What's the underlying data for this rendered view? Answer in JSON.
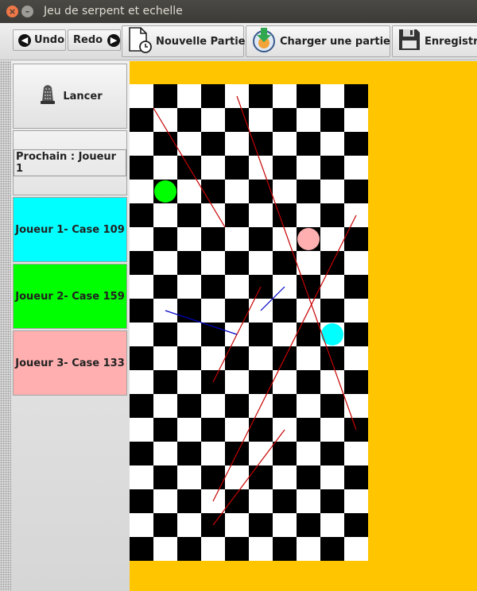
{
  "window": {
    "title": "Jeu de serpent et echelle",
    "close_glyph": "×",
    "minimize_glyph": "–"
  },
  "toolbar": {
    "undo_label": "Undo",
    "redo_label": "Redo",
    "new_game_label": "Nouvelle Partie",
    "load_game_label": "Charger une partie",
    "save_label": "Enregistr",
    "undo_glyph": "◀",
    "redo_glyph": "▶"
  },
  "side": {
    "roll_label": "Lancer",
    "next_label": "Prochain : Joueur 1",
    "players": [
      {
        "label": "Joueur 1- Case 109",
        "color": "#00ffff"
      },
      {
        "label": "Joueur 2- Case 159",
        "color": "#00ff00"
      },
      {
        "label": "Joueur 3- Case 133",
        "color": "#ffafaf"
      }
    ]
  },
  "board": {
    "columns": 10,
    "rows": 20,
    "dark_color": "#000000",
    "light_color": "#ffffff",
    "background_color": "#ffc600",
    "ladder_color": "#0000c8",
    "snake_color": "#c80000",
    "tokens": [
      {
        "player": "Joueur 1",
        "color": "#00ffff",
        "col": 8,
        "row": 10
      },
      {
        "player": "Joueur 2",
        "color": "#00ff00",
        "col": 1,
        "row": 4
      },
      {
        "player": "Joueur 3",
        "color": "#ffafaf",
        "col": 7,
        "row": 6
      }
    ],
    "lines": [
      {
        "kind": "snake",
        "from": [
          1,
          1
        ],
        "to": [
          4,
          6
        ]
      },
      {
        "kind": "snake",
        "from": [
          4.5,
          0.5
        ],
        "to": [
          9.5,
          14.5
        ]
      },
      {
        "kind": "snake",
        "from": [
          9.5,
          5.5
        ],
        "to": [
          3.5,
          17.5
        ]
      },
      {
        "kind": "snake",
        "from": [
          5.5,
          8.5
        ],
        "to": [
          3.5,
          12.5
        ]
      },
      {
        "kind": "snake",
        "from": [
          6.5,
          14.5
        ],
        "to": [
          3.5,
          18.5
        ]
      },
      {
        "kind": "ladder",
        "from": [
          1.5,
          9.5
        ],
        "to": [
          4.5,
          10.5
        ]
      },
      {
        "kind": "ladder",
        "from": [
          6.5,
          8.5
        ],
        "to": [
          5.5,
          9.5
        ]
      }
    ]
  }
}
